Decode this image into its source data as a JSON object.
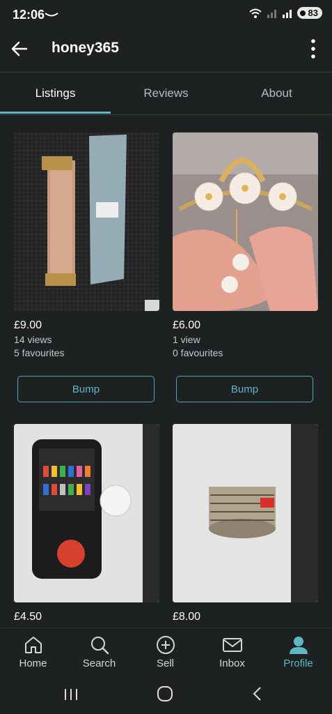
{
  "status": {
    "time": "12:06",
    "battery": "83"
  },
  "header": {
    "title": "honey365"
  },
  "tabs": [
    "Listings",
    "Reviews",
    "About"
  ],
  "listings": [
    {
      "price": "£9.00",
      "views": "14 views",
      "favourites": "5 favourites",
      "bump": "Bump"
    },
    {
      "price": "£6.00",
      "views": "1 view",
      "favourites": "0 favourites",
      "bump": "Bump"
    },
    {
      "price": "£4.50"
    },
    {
      "price": "£8.00"
    }
  ],
  "nav": [
    {
      "label": "Home",
      "icon": "home-icon"
    },
    {
      "label": "Search",
      "icon": "search-icon"
    },
    {
      "label": "Sell",
      "icon": "plus-circle-icon"
    },
    {
      "label": "Inbox",
      "icon": "mail-icon"
    },
    {
      "label": "Profile",
      "icon": "person-icon"
    }
  ],
  "colors": {
    "accent": "#5fb7c2",
    "background": "#1d2122"
  }
}
